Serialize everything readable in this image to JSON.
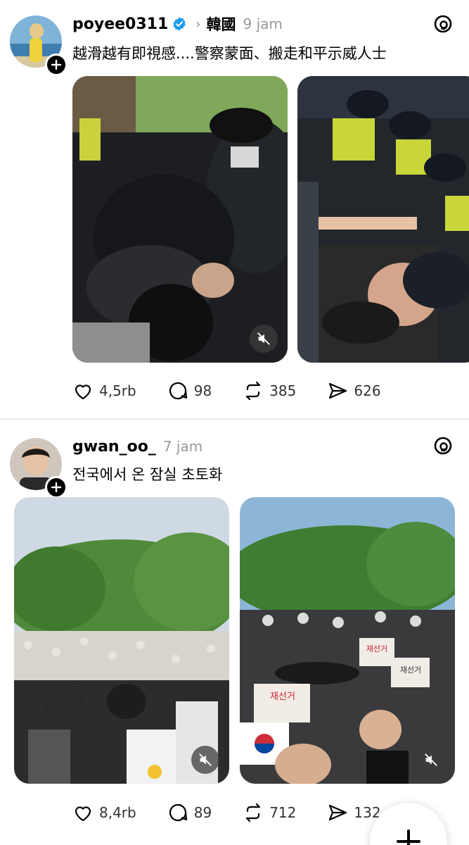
{
  "posts": [
    {
      "username": "poyee0311",
      "verified": true,
      "region": "韓國",
      "time": "9 jam",
      "text": "越滑越有即視感....警察蒙面、搬走和平示威人士",
      "likes": "4,5rb",
      "replies": "98",
      "reposts": "385",
      "shares": "626"
    },
    {
      "username": "gwan_oo_",
      "verified": false,
      "time": "7 jam",
      "text": "전국에서 온 잠실 초토화",
      "likes": "8,4rb",
      "replies": "89",
      "reposts": "712",
      "shares": "132",
      "placards": [
        "재선거",
        "재선거",
        "재선거"
      ]
    }
  ],
  "icons": {
    "follow": "plus-icon",
    "verified": "verified-badge-icon",
    "threads": "threads-logo-icon",
    "mute": "speaker-muted-icon",
    "like": "heart-icon",
    "reply": "comment-bubble-icon",
    "repost": "repost-icon",
    "share": "paper-plane-icon",
    "compose": "plus-icon"
  },
  "colors": {
    "verified": "#1d9bf0",
    "muted_text": "#999999",
    "accent": "#000000"
  }
}
